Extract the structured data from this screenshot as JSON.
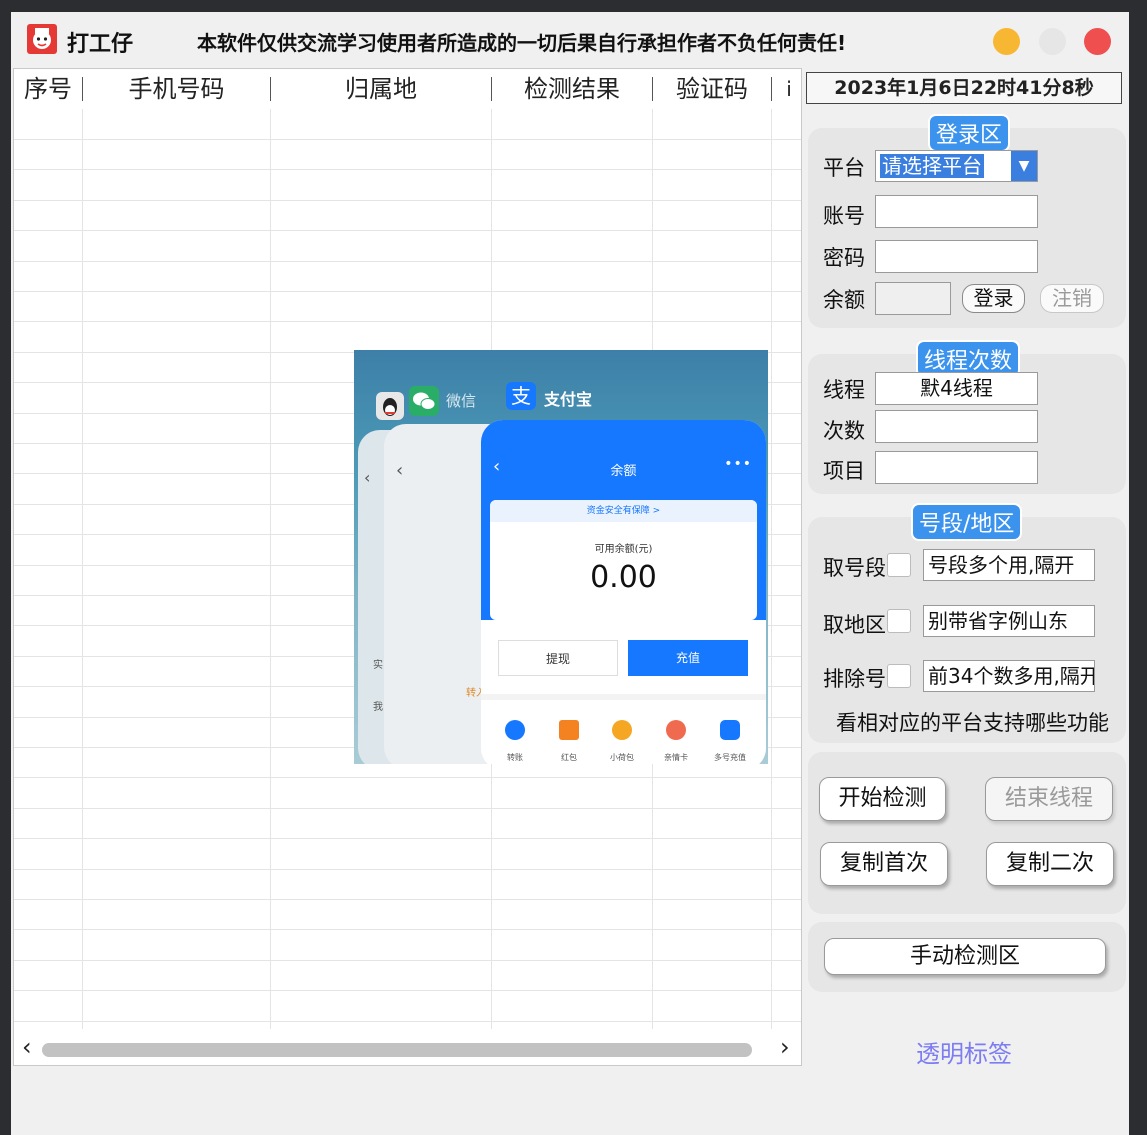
{
  "window": {
    "title": "打工仔",
    "notice": "本软件仅供交流学习使用者所造成的一切后果自行承担作者不负任何责任!"
  },
  "table": {
    "columns": [
      "序号",
      "手机号码",
      "归属地",
      "检测结果",
      "验证码",
      "i"
    ]
  },
  "datetime": "2023年1月6日22时41分8秒",
  "login": {
    "title": "登录区",
    "platform_label": "平台",
    "platform_value": "请选择平台",
    "account_label": "账号",
    "password_label": "密码",
    "balance_label": "余额",
    "login_button": "登录",
    "logout_button": "注销"
  },
  "threads": {
    "title": "线程次数",
    "thread_label": "线程",
    "thread_value": "默4线程",
    "count_label": "次数",
    "project_label": "项目"
  },
  "segment": {
    "title": "号段/地区",
    "prefix_label": "取号段",
    "prefix_value": "号段多个用,隔开",
    "region_label": "取地区",
    "region_value": "别带省字例山东",
    "exclude_label": "排除号",
    "exclude_value": "前34个数多用,隔开",
    "hint": "看相对应的平台支持哪些功能"
  },
  "actions": {
    "start": "开始检测",
    "stop": "结束线程",
    "copy_first": "复制首次",
    "copy_second": "复制二次",
    "manual": "手动检测区"
  },
  "footer_link": "透明标签",
  "overlay": {
    "wechat_label": "微信",
    "alipay_label": "支付宝",
    "header": "余额",
    "safety": "资金安全有保障 >",
    "available_label": "可用余额(元)",
    "amount": "0.00",
    "withdraw": "提现",
    "topup": "充值",
    "icons": [
      "转账",
      "红包",
      "小荷包",
      "亲情卡",
      "多号充值"
    ],
    "side_texts": [
      "实",
      "我",
      "转入"
    ]
  },
  "colors": {
    "accent": "#3b93ee",
    "alipay_blue": "#1677ff",
    "minimize": "#f7b733",
    "close": "#ef4f4f",
    "link": "#7d7df2"
  }
}
